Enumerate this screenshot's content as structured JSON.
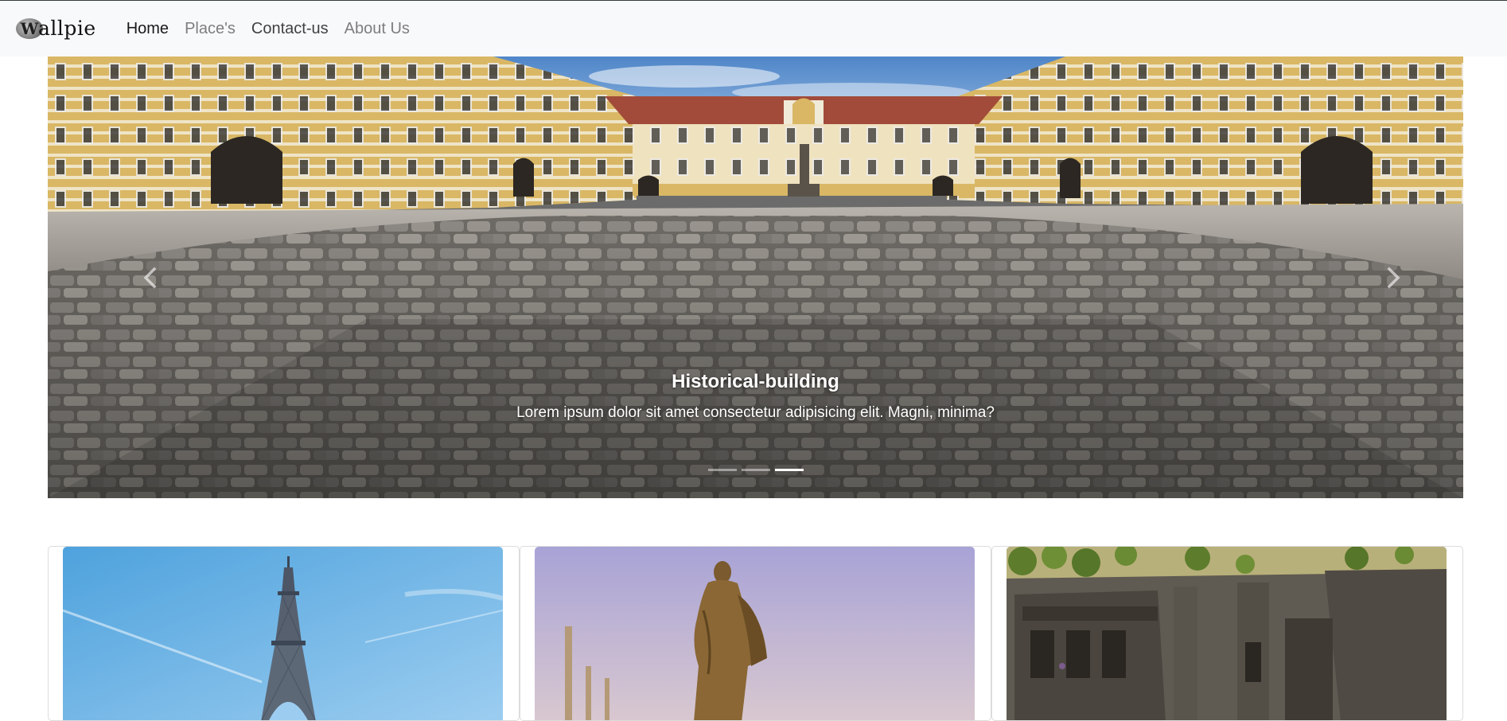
{
  "navbar": {
    "brand_logo_letter": "W",
    "brand_text": "allpie",
    "links": [
      {
        "label": "Home",
        "state": "active"
      },
      {
        "label": "Place's",
        "state": "muted"
      },
      {
        "label": "Contact-us",
        "state": "strong"
      },
      {
        "label": "About Us",
        "state": "muted"
      }
    ]
  },
  "carousel": {
    "caption_title": "Historical-building",
    "caption_text": "Lorem ipsum dolor sit amet consectetur adipisicing elit. Magni, minima?",
    "slide_count": 3,
    "active_slide": 3,
    "prev_icon": "chevron-left-icon",
    "next_icon": "chevron-right-icon"
  },
  "cards": [
    {
      "image": "eiffel-tower-photo"
    },
    {
      "image": "statue-photo"
    },
    {
      "image": "rock-cut-temple-photo"
    }
  ],
  "colors": {
    "navbar_bg": "#f8f9fa",
    "facade_yellow": "#d9b765",
    "roof_red": "#a24b3a",
    "sky_blue": "#5b8fcc"
  }
}
